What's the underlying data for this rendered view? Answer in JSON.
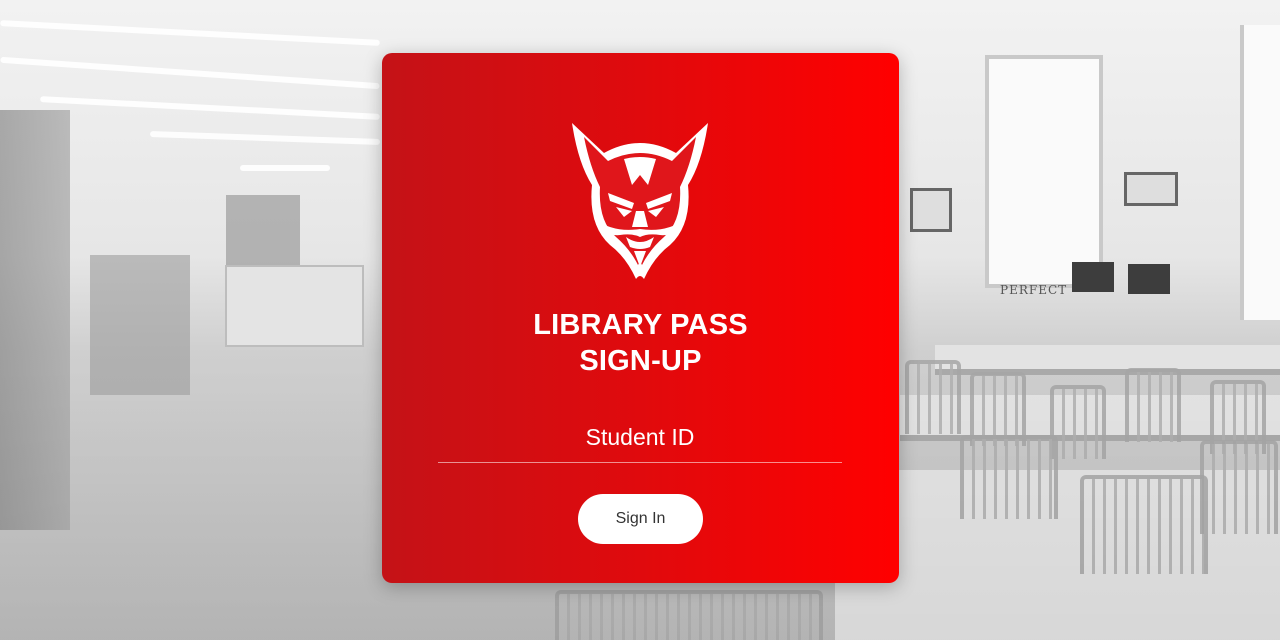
{
  "card": {
    "title_line1": "LIBRARY PASS",
    "title_line2": "SIGN-UP",
    "logo": "devil-mascot-logo"
  },
  "form": {
    "student_id_placeholder": "Student ID",
    "student_id_value": "",
    "sign_in_label": "Sign In"
  },
  "background": {
    "scene": "library-interior-photo",
    "sign_text": "PERFECT"
  },
  "colors": {
    "card_left": "#c41217",
    "card_right": "#ff0000",
    "button_bg": "#ffffff",
    "button_text": "#333333"
  }
}
